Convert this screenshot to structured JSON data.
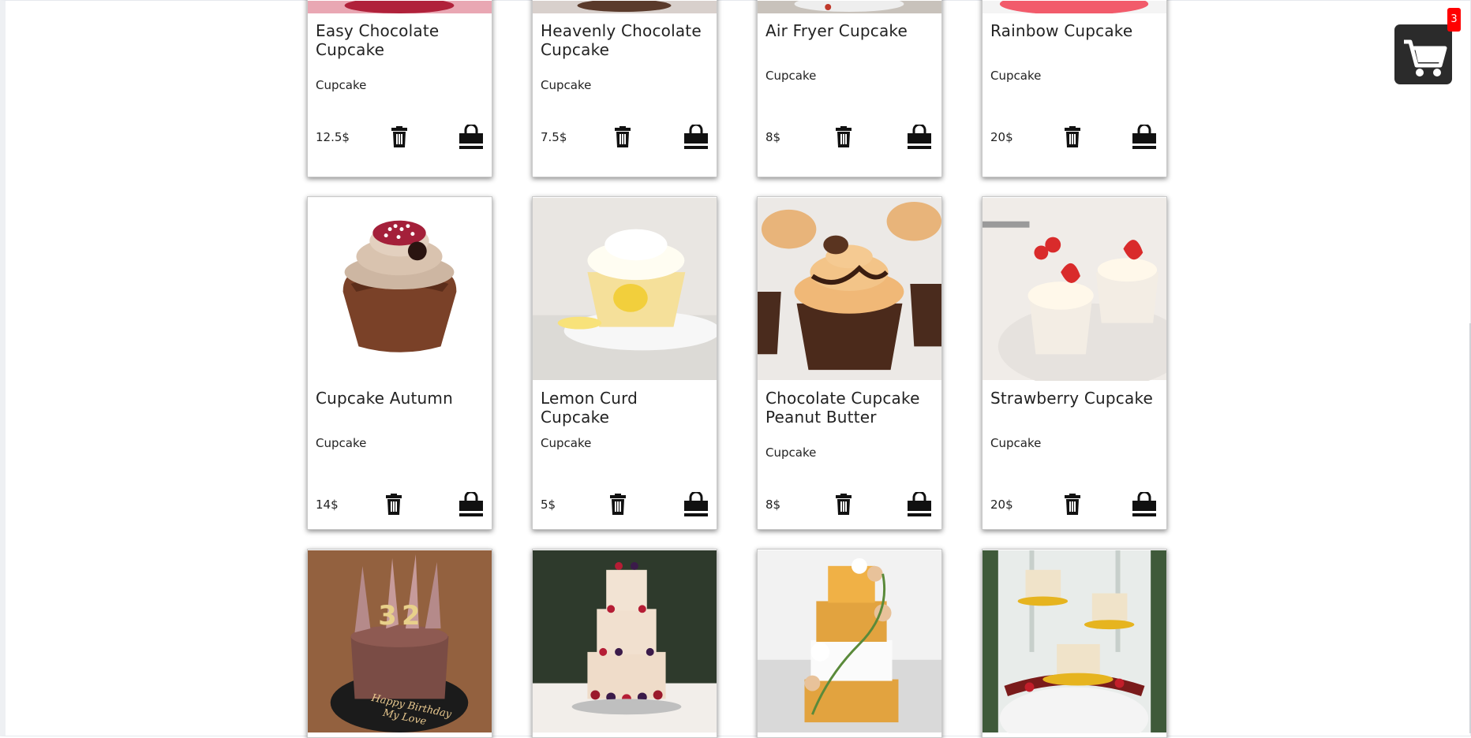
{
  "cart": {
    "badge_count": "3",
    "icon": "shopping-cart-icon"
  },
  "products": [
    {
      "name": "Easy Chocolate Cupcake",
      "category": "Cupcake",
      "price": "12.5$",
      "image": "chocolate-cupcake-image"
    },
    {
      "name": "Heavenly Chocolate Cupcake",
      "category": "Cupcake",
      "price": "7.5$",
      "image": "chocolate-cupcake-image"
    },
    {
      "name": "Air Fryer Cupcake",
      "category": "Cupcake",
      "price": "8$",
      "image": "air-fryer-cupcake-image"
    },
    {
      "name": "Rainbow Cupcake",
      "category": "Cupcake",
      "price": "20$",
      "image": "rainbow-cupcake-image"
    },
    {
      "name": "Cupcake Autumn",
      "category": "Cupcake",
      "price": "14$",
      "image": "chocolate-cup-cupcake-image"
    },
    {
      "name": "Lemon Curd Cupcake",
      "category": "Cupcake",
      "price": "5$",
      "image": "lemon-cupcake-image"
    },
    {
      "name": "Chocolate Cupcake Peanut Butter",
      "category": "Cupcake",
      "price": "8$",
      "image": "peanut-butter-cupcake-image"
    },
    {
      "name": "Strawberry Cupcake",
      "category": "Cupcake",
      "price": "20$",
      "image": "strawberry-cupcake-image"
    },
    {
      "name": "",
      "category": "",
      "price": "",
      "image": "birthday-cake-image",
      "image_text": "32 Happy Birthday My Love"
    },
    {
      "name": "",
      "category": "",
      "price": "",
      "image": "naked-berry-cake-image"
    },
    {
      "name": "",
      "category": "",
      "price": "",
      "image": "floral-tiered-cake-image"
    },
    {
      "name": "",
      "category": "",
      "price": "",
      "image": "gold-stand-cakes-image"
    }
  ],
  "icons": {
    "delete": "trash-icon",
    "buy": "shopping-bag-icon"
  },
  "colors": {
    "badge": "#ff0000",
    "cart_bg": "#2b2b2b",
    "text": "#222222"
  }
}
